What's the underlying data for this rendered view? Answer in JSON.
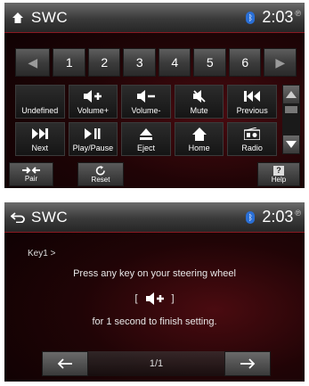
{
  "screen1": {
    "title": "SWC",
    "clock": "2:03",
    "clock_suffix": "℗",
    "bluetooth_icon": "bluetooth-icon",
    "number_row": {
      "left_arrow": "◀",
      "numbers": [
        "1",
        "2",
        "3",
        "4",
        "5",
        "6"
      ],
      "right_arrow": "▶"
    },
    "keys": [
      {
        "label": "Undefined",
        "icon": "none"
      },
      {
        "label": "Volume+",
        "icon": "volume-up-icon"
      },
      {
        "label": "Volume-",
        "icon": "volume-down-icon"
      },
      {
        "label": "Mute",
        "icon": "mute-icon"
      },
      {
        "label": "Previous",
        "icon": "previous-icon"
      },
      {
        "label": "Next",
        "icon": "next-icon"
      },
      {
        "label": "Play/Pause",
        "icon": "play-pause-icon"
      },
      {
        "label": "Eject",
        "icon": "eject-icon"
      },
      {
        "label": "Home",
        "icon": "home-icon"
      },
      {
        "label": "Radio",
        "icon": "radio-icon"
      }
    ],
    "pair_label": "Pair",
    "reset_label": "Reset",
    "help_label": "Help",
    "help_glyph": "?"
  },
  "screen2": {
    "title": "SWC",
    "clock": "2:03",
    "clock_suffix": "℗",
    "key_label": "Key1 >",
    "instruction": "Press any key on your steering wheel",
    "bracket_open": "[",
    "bracket_close": "]",
    "duration_text": "for 1 second to finish setting.",
    "pager": "1/1",
    "prev_arrow": "←",
    "next_arrow": "→"
  },
  "colors": {
    "accent_red": "#8a1a22",
    "bluetooth_blue": "#2a6fd6",
    "background_dark": "#200406"
  }
}
